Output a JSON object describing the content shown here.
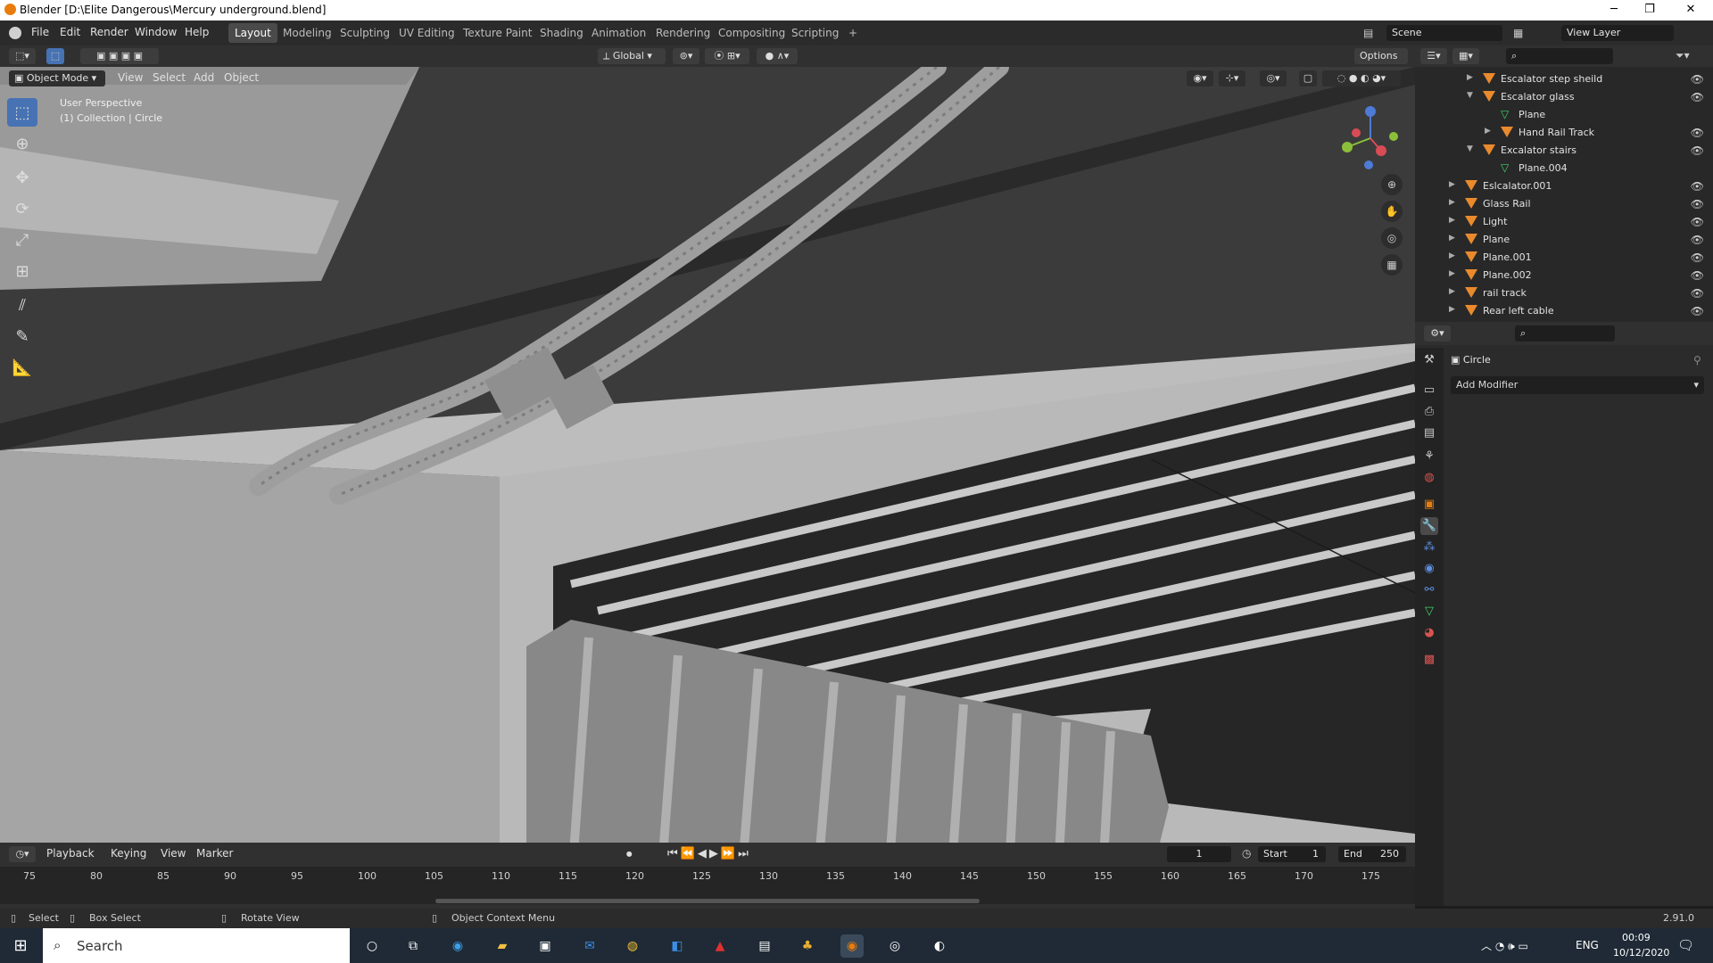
{
  "window": {
    "title": "Blender [D:\\Elite Dangerous\\Mercury underground.blend]",
    "min": "─",
    "max": "❐",
    "close": "✕"
  },
  "menu": [
    "File",
    "Edit",
    "Render",
    "Window",
    "Help"
  ],
  "workspaces": [
    "Layout",
    "Modeling",
    "Sculpting",
    "UV Editing",
    "Texture Paint",
    "Shading",
    "Animation",
    "Rendering",
    "Compositing",
    "Scripting",
    "+"
  ],
  "scene": {
    "label": "Scene",
    "view_layer": "View Layer"
  },
  "viewport_header": {
    "transform_orientation": "Global",
    "options": "Options",
    "mode": "Object Mode",
    "menus": [
      "View",
      "Select",
      "Add",
      "Object"
    ]
  },
  "viewport": {
    "perspective": "User Perspective",
    "collection": "(1) Collection | Circle"
  },
  "outliner": {
    "items": [
      {
        "label": "Escalator step sheild",
        "level": 2,
        "expanded": false
      },
      {
        "label": "Escalator glass",
        "level": 2,
        "expanded": true
      },
      {
        "label": "Plane",
        "level": 3,
        "mesh": true
      },
      {
        "label": "Hand Rail Track",
        "level": 3,
        "expanded": false
      },
      {
        "label": "Excalator stairs",
        "level": 2,
        "expanded": true
      },
      {
        "label": "Plane.004",
        "level": 3,
        "mesh": true
      },
      {
        "label": "Eslcalator.001",
        "level": 1,
        "expanded": false
      },
      {
        "label": "Glass Rail",
        "level": 1,
        "expanded": false
      },
      {
        "label": "Light",
        "level": 1,
        "expanded": false
      },
      {
        "label": "Plane",
        "level": 1,
        "expanded": false
      },
      {
        "label": "Plane.001",
        "level": 1,
        "expanded": false
      },
      {
        "label": "Plane.002",
        "level": 1,
        "expanded": false
      },
      {
        "label": "rail track",
        "level": 1,
        "expanded": false
      },
      {
        "label": "Rear left cable",
        "level": 1,
        "expanded": false
      }
    ]
  },
  "properties": {
    "object_name": "Circle",
    "add_modifier": "Add Modifier"
  },
  "timeline": {
    "menus": [
      "Playback",
      "Keying",
      "View",
      "Marker"
    ],
    "current_frame": "1",
    "start_label": "Start",
    "start": "1",
    "end_label": "End",
    "end": "250",
    "ticks": [
      "75",
      "80",
      "85",
      "90",
      "95",
      "100",
      "105",
      "110",
      "115",
      "120",
      "125",
      "130",
      "135",
      "140",
      "145",
      "150",
      "155",
      "160",
      "165",
      "170",
      "175"
    ]
  },
  "status": {
    "select": "Select",
    "box_select": "Box Select",
    "rotate": "Rotate View",
    "context": "Object Context Menu",
    "version": "2.91.0"
  },
  "taskbar": {
    "search": "Search",
    "lang": "ENG",
    "time": "00:09",
    "date": "10/12/2020"
  },
  "colors": {
    "accent": "#4772b3",
    "orange": "#e87d0d",
    "viewport_bg": "#3a3a3a"
  }
}
